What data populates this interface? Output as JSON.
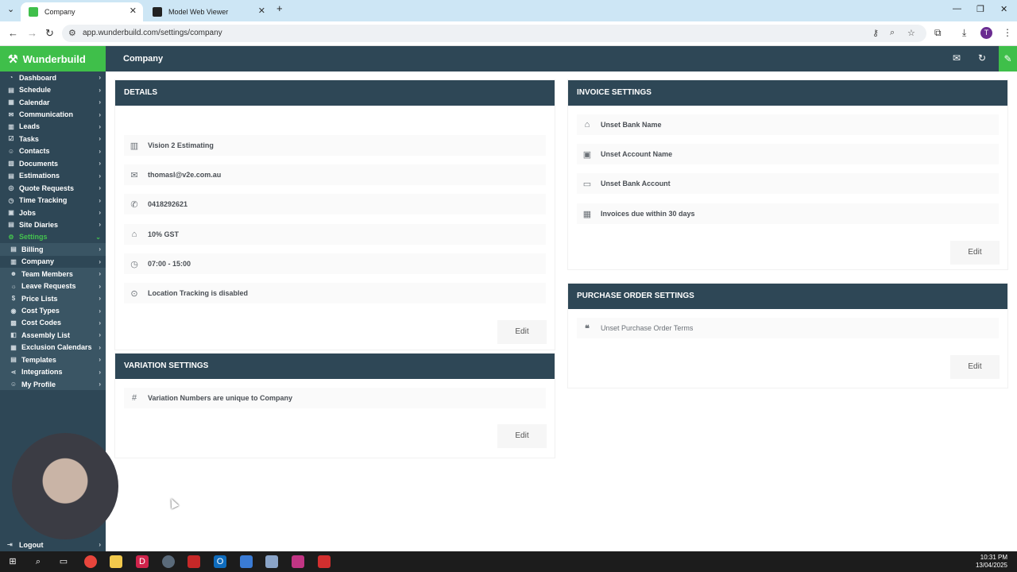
{
  "browser": {
    "tabs": [
      {
        "title": "Company",
        "active": true
      },
      {
        "title": "Model Web Viewer",
        "active": false
      }
    ],
    "url": "app.wunderbuild.com/settings/company",
    "profile_initial": "T"
  },
  "app": {
    "brand": "Wunderbuild",
    "page_title": "Company",
    "accent_color": "#3fbf4a",
    "nav_color": "#2e4756"
  },
  "sidebar": {
    "items": [
      {
        "label": "Dashboard",
        "icon": "dashboard-icon"
      },
      {
        "label": "Schedule",
        "icon": "schedule-icon"
      },
      {
        "label": "Calendar",
        "icon": "calendar-icon"
      },
      {
        "label": "Communication",
        "icon": "chat-icon"
      },
      {
        "label": "Leads",
        "icon": "leads-icon"
      },
      {
        "label": "Tasks",
        "icon": "tasks-icon"
      },
      {
        "label": "Contacts",
        "icon": "contacts-icon"
      },
      {
        "label": "Documents",
        "icon": "documents-icon"
      },
      {
        "label": "Estimations",
        "icon": "estimations-icon"
      },
      {
        "label": "Quote Requests",
        "icon": "quote-icon"
      },
      {
        "label": "Time Tracking",
        "icon": "clock-icon"
      },
      {
        "label": "Jobs",
        "icon": "jobs-icon"
      },
      {
        "label": "Site Diaries",
        "icon": "diary-icon"
      },
      {
        "label": "Settings",
        "icon": "gear-icon"
      }
    ],
    "sub_items": [
      {
        "label": "Billing",
        "icon": "billing-icon"
      },
      {
        "label": "Company",
        "icon": "company-icon"
      },
      {
        "label": "Team Members",
        "icon": "team-icon"
      },
      {
        "label": "Leave Requests",
        "icon": "leave-icon"
      },
      {
        "label": "Price Lists",
        "icon": "price-list-icon"
      },
      {
        "label": "Cost Types",
        "icon": "cost-types-icon"
      },
      {
        "label": "Cost Codes",
        "icon": "cost-codes-icon"
      },
      {
        "label": "Assembly List",
        "icon": "assembly-icon"
      },
      {
        "label": "Exclusion Calendars",
        "icon": "exclusion-calendar-icon"
      },
      {
        "label": "Templates",
        "icon": "templates-icon"
      },
      {
        "label": "Integrations",
        "icon": "integrations-icon"
      },
      {
        "label": "My Profile",
        "icon": "profile-icon"
      }
    ],
    "logout": "Logout"
  },
  "details": {
    "heading": "DETAILS",
    "rows": [
      {
        "icon": "building-icon",
        "text": "Vision 2 Estimating"
      },
      {
        "icon": "mail-icon",
        "text": "thomasl@v2e.com.au"
      },
      {
        "icon": "phone-icon",
        "text": "0418292621"
      },
      {
        "icon": "tag-icon",
        "text": "10% GST"
      },
      {
        "icon": "clock-icon",
        "text": "07:00 - 15:00"
      },
      {
        "icon": "location-icon",
        "text": "Location Tracking is disabled"
      }
    ],
    "edit_label": "Edit"
  },
  "variation": {
    "heading": "VARIATION SETTINGS",
    "rows": [
      {
        "icon": "hash-icon",
        "text": "Variation Numbers are unique to Company"
      }
    ],
    "edit_label": "Edit"
  },
  "invoice": {
    "heading": "INVOICE SETTINGS",
    "rows": [
      {
        "icon": "bank-icon",
        "text": "Unset Bank Name"
      },
      {
        "icon": "account-icon",
        "text": "Unset Account Name"
      },
      {
        "icon": "card-icon",
        "text": "Unset Bank Account"
      },
      {
        "icon": "calendar-icon",
        "text": "Invoices due within 30 days"
      }
    ],
    "edit_label": "Edit"
  },
  "purchase_order": {
    "heading": "PURCHASE ORDER SETTINGS",
    "rows": [
      {
        "icon": "quote-marks-icon",
        "text": "Unset Purchase Order Terms"
      }
    ],
    "edit_label": "Edit"
  },
  "taskbar": {
    "time": "10:31 PM",
    "date": "13/04/2025"
  }
}
